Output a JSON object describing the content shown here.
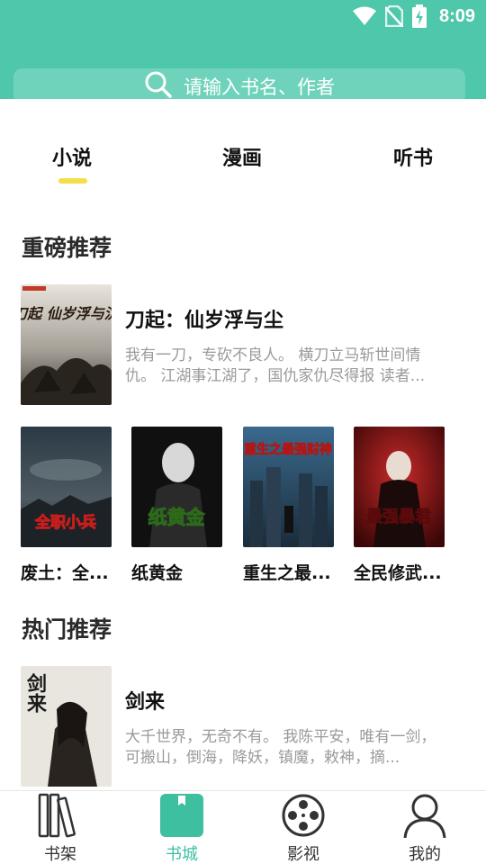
{
  "status_bar": {
    "time": "8:09"
  },
  "search": {
    "placeholder": "请输入书名、作者"
  },
  "tabs": [
    {
      "label": "小说",
      "active": true
    },
    {
      "label": "漫画",
      "active": false
    },
    {
      "label": "听书",
      "active": false
    }
  ],
  "sections": [
    {
      "title": "重磅推荐",
      "feature": {
        "title": "刀起：仙岁浮与尘",
        "desc": "我有一刀，专砍不良人。 横刀立马斩世间情仇。 江湖事江湖了，国仇家仇尽得报 读者...",
        "cover_text": "刀起 仙岁浮与沉"
      },
      "grid": [
        {
          "title": "废土：全...",
          "cover_text": "全职小兵"
        },
        {
          "title": "纸黄金",
          "cover_text": "纸黄金"
        },
        {
          "title": "重生之最...",
          "cover_text": "重生之最强财神"
        },
        {
          "title": "全民修武...",
          "cover_text": "最强暴君"
        }
      ]
    },
    {
      "title": "热门推荐",
      "feature": {
        "title": "剑来",
        "desc": "大千世界，无奇不有。 我陈平安，唯有一剑，可搬山，倒海，降妖，镇魔，敕神，摘...",
        "cover_text": "剑来"
      }
    }
  ],
  "bottom_nav": [
    {
      "label": "书架",
      "icon": "bookshelf-icon",
      "active": false
    },
    {
      "label": "书城",
      "icon": "bookstore-icon",
      "active": true
    },
    {
      "label": "影视",
      "icon": "film-reel-icon",
      "active": false
    },
    {
      "label": "我的",
      "icon": "profile-icon",
      "active": false
    }
  ],
  "colors": {
    "accent": "#4fc7aa",
    "active_nav": "#3dbfa0",
    "tab_underline": "#f2df4a"
  }
}
